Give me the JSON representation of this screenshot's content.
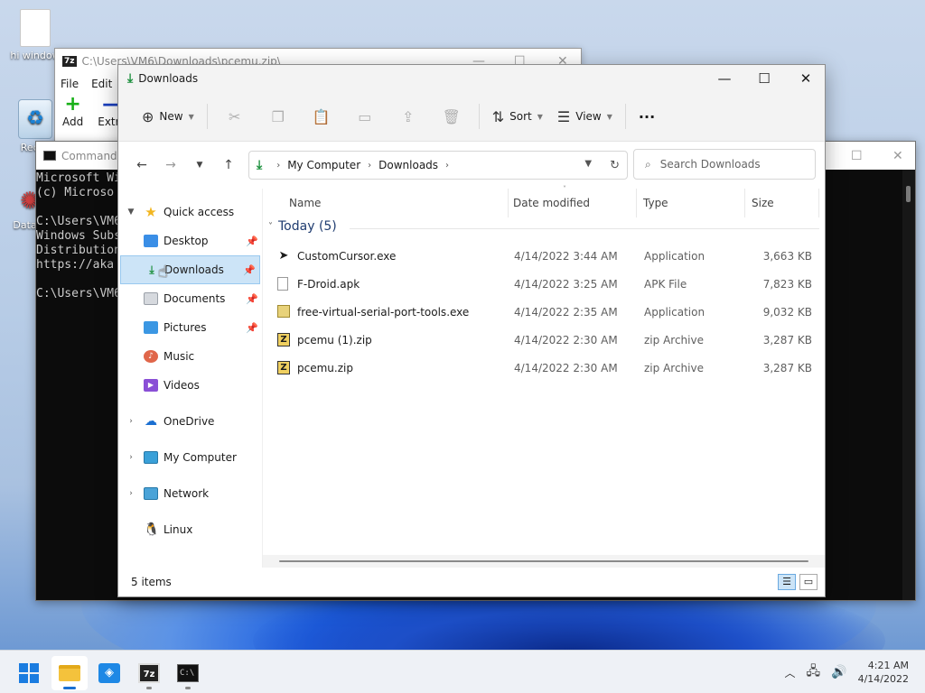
{
  "desktop": {
    "icons": [
      {
        "label": "hi window"
      },
      {
        "label": "Recyc"
      },
      {
        "label": "DataW"
      }
    ]
  },
  "window_7zip": {
    "badge": "7z",
    "title": "C:\\Users\\VM6\\Downloads\\pcemu.zip\\",
    "menu": [
      "File",
      "Edit"
    ],
    "tools": [
      {
        "label": "Add",
        "glyph": "+"
      },
      {
        "label": "Extra",
        "glyph": "—"
      }
    ]
  },
  "window_cmd": {
    "title": "Command",
    "lines": "Microsoft Wi\n(c) Microso\n\nC:\\Users\\VM6\nWindows Subs\nDistribution\nhttps://aka\n\nC:\\Users\\VM6"
  },
  "explorer": {
    "title": "Downloads",
    "toolbar": {
      "new_label": "New",
      "sort_label": "Sort",
      "view_label": "View",
      "more_label": "···"
    },
    "address": {
      "crumbs": [
        "My Computer",
        "Downloads"
      ]
    },
    "search": {
      "placeholder": "Search Downloads"
    },
    "nav": {
      "quick_access": "Quick access",
      "items": [
        {
          "label": "Desktop"
        },
        {
          "label": "Downloads"
        },
        {
          "label": "Documents"
        },
        {
          "label": "Pictures"
        },
        {
          "label": "Music"
        },
        {
          "label": "Videos"
        }
      ],
      "roots": [
        {
          "label": "OneDrive"
        },
        {
          "label": "My Computer"
        },
        {
          "label": "Network"
        },
        {
          "label": "Linux"
        }
      ]
    },
    "columns": {
      "name": "Name",
      "date": "Date modified",
      "type": "Type",
      "size": "Size"
    },
    "group_label": "Today (5)",
    "files": [
      {
        "name": "CustomCursor.exe",
        "date": "4/14/2022 3:44 AM",
        "type": "Application",
        "size": "3,663 KB"
      },
      {
        "name": "F-Droid.apk",
        "date": "4/14/2022 3:25 AM",
        "type": "APK File",
        "size": "7,823 KB"
      },
      {
        "name": "free-virtual-serial-port-tools.exe",
        "date": "4/14/2022 2:35 AM",
        "type": "Application",
        "size": "9,032 KB"
      },
      {
        "name": "pcemu (1).zip",
        "date": "4/14/2022 2:30 AM",
        "type": "zip Archive",
        "size": "3,287 KB"
      },
      {
        "name": "pcemu.zip",
        "date": "4/14/2022 2:30 AM",
        "type": "zip Archive",
        "size": "3,287 KB"
      }
    ],
    "status_text": "5 items"
  },
  "taskbar": {
    "sz_badge": "7z",
    "time": "4:21 AM",
    "date": "4/14/2022"
  }
}
